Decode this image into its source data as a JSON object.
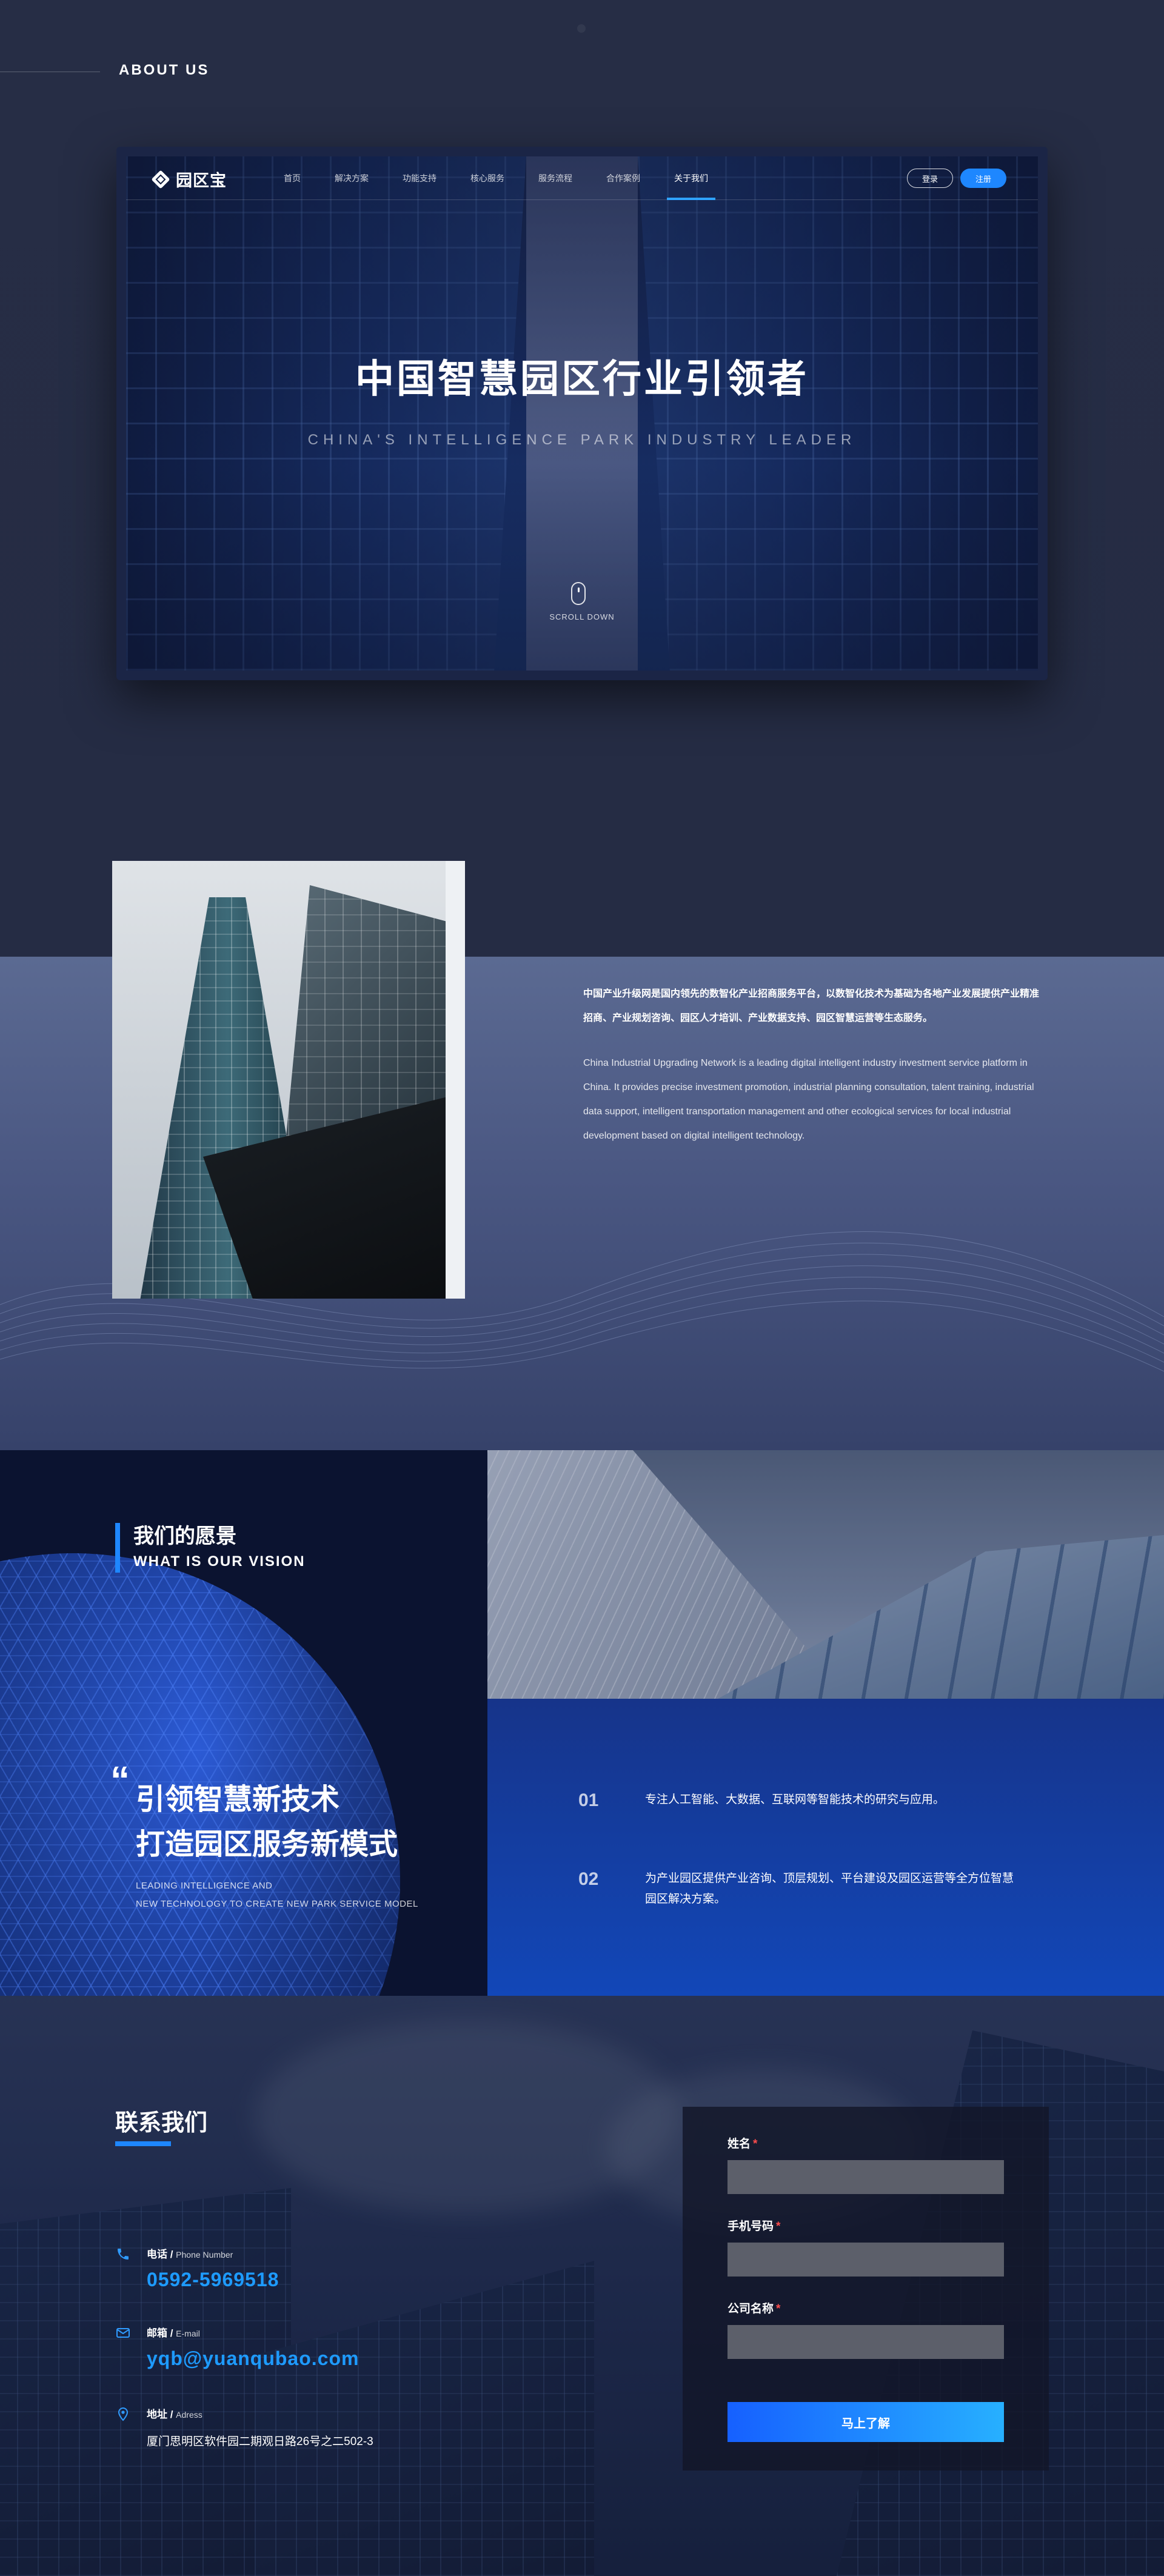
{
  "about": {
    "section_tag": "ABOUT US",
    "nav": {
      "logo_text": "园区宝",
      "items": [
        {
          "label": "首页",
          "active": false
        },
        {
          "label": "解决方案",
          "active": false
        },
        {
          "label": "功能支持",
          "active": false
        },
        {
          "label": "核心服务",
          "active": false
        },
        {
          "label": "服务流程",
          "active": false
        },
        {
          "label": "合作案例",
          "active": false
        },
        {
          "label": "关于我们",
          "active": true
        }
      ],
      "login_label": "登录",
      "register_label": "注册"
    },
    "hero_title": "中国智慧园区行业引领者",
    "hero_subtitle": "CHINA'S INTELLIGENCE PARK INDUSTRY LEADER",
    "scroll_label": "SCROLL DOWN"
  },
  "intro": {
    "text_cn": "中国产业升级网是国内领先的数智化产业招商服务平台，以数智化技术为基础为各地产业发展提供产业精准招商、产业规划咨询、园区人才培训、产业数据支持、园区智慧运营等生态服务。",
    "text_en": "China Industrial Upgrading Network is a leading digital intelligent industry investment service platform in China. It provides precise investment promotion, industrial planning consultation, talent training, industrial data support, intelligent transportation management and other ecological services for local industrial development based on digital intelligent technology."
  },
  "vision": {
    "title_cn": "我们的愿景",
    "title_en": "WHAT IS OUR VISION",
    "slogan_line1": "引领智慧新技术",
    "slogan_line2": "打造园区服务新模式",
    "slogan_en_line1": "LEADING INTELLIGENCE AND",
    "slogan_en_line2": "NEW TECHNOLOGY TO CREATE NEW PARK SERVICE MODEL",
    "items": [
      {
        "num": "01",
        "text": "专注人工智能、大数据、互联网等智能技术的研究与应用。"
      },
      {
        "num": "02",
        "text": "为产业园区提供产业咨询、顶层规划、平台建设及园区运营等全方位智慧园区解决方案。"
      }
    ]
  },
  "contact": {
    "title": "联系我们",
    "phone": {
      "label": "电话",
      "sub": "Phone Number",
      "value": "0592-5969518",
      "icon": "phone-icon"
    },
    "email": {
      "label": "邮箱",
      "sub": "E-mail",
      "value": "yqb@yuanqubao.com",
      "icon": "mail-icon"
    },
    "address": {
      "label": "地址",
      "sub": "Adress",
      "value": "厦门思明区软件园二期观日路26号之二502-3",
      "icon": "location-pin-icon"
    },
    "form": {
      "name_label": "姓名",
      "phone_label": "手机号码",
      "company_label": "公司名称",
      "required_mark": "*",
      "submit_label": "马上了解"
    }
  },
  "colors": {
    "accent": "#1e87ff",
    "link_blue": "#1e9bff",
    "required": "#ff4d4d",
    "page_bg": "#252c43"
  }
}
